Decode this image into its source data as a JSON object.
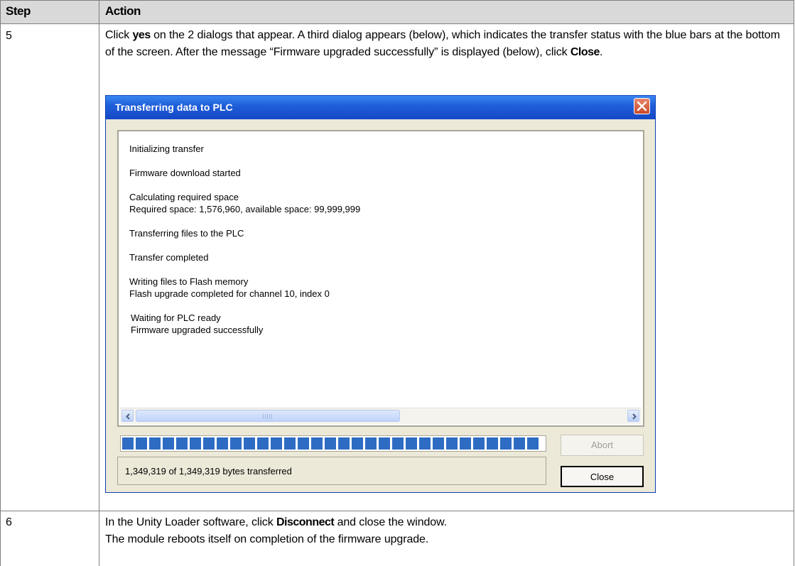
{
  "table": {
    "headers": {
      "step": "Step",
      "action": "Action"
    },
    "rows": [
      {
        "step": "5",
        "segments": [
          {
            "t": "Click ",
            "bold": false
          },
          {
            "t": "yes",
            "bold": true
          },
          {
            "t": " on the 2 dialogs that appear. A third dialog appears (below), which indicates the transfer status with the blue bars at the bottom of the screen. After the message “Firmware upgraded successfully” is displayed (below), click ",
            "bold": false
          },
          {
            "t": "Close",
            "bold": true
          },
          {
            "t": ".",
            "bold": false
          }
        ]
      },
      {
        "step": "6",
        "line1": [
          {
            "t": "In the Unity Loader software, click ",
            "bold": false
          },
          {
            "t": "Disconnect",
            "bold": true
          },
          {
            "t": " and close the window.",
            "bold": false
          }
        ],
        "line2": "The module reboots itself on completion of the firmware upgrade."
      }
    ]
  },
  "dialog": {
    "title": "Transferring data to PLC",
    "log": [
      "Initializing transfer",
      "Firmware download started",
      "Calculating required space",
      "Required space: 1,576,960, available space: 99,999,999",
      "Transferring files to the PLC",
      "Transfer completed",
      "Writing files to Flash memory",
      "Flash upgrade completed for channel 10, index 0",
      "Waiting for PLC ready",
      "Firmware upgraded successfully"
    ],
    "progress": 1.0,
    "status": "1,349,319 of 1,349,319 bytes transferred",
    "abort_label": "Abort",
    "close_label": "Close",
    "colors": {
      "titlebar": "#1f5fd9",
      "progress": "#2e6cc4",
      "face": "#ece9d8"
    }
  }
}
